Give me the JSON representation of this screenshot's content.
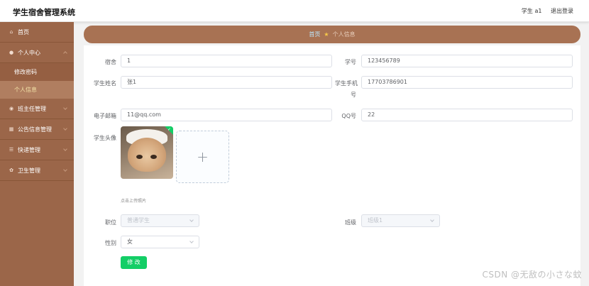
{
  "header": {
    "title": "学生宿舍管理系统",
    "user": "学生 a1",
    "logout": "退出登录"
  },
  "sidebar": {
    "items": [
      {
        "label": "首页",
        "icon": "home-icon"
      },
      {
        "label": "个人中心",
        "icon": "user-icon"
      },
      {
        "label": "班主任管理",
        "icon": "location-icon"
      },
      {
        "label": "公告信息管理",
        "icon": "grid-icon"
      },
      {
        "label": "快递管理",
        "icon": "list-icon"
      },
      {
        "label": "卫生管理",
        "icon": "settings-icon"
      }
    ],
    "sub_items": [
      {
        "label": "修改密码"
      },
      {
        "label": "个人信息"
      }
    ]
  },
  "breadcrumb": {
    "home": "首页",
    "current": "个人信息"
  },
  "form": {
    "dorm_label": "宿舍",
    "dorm_value": "1",
    "student_no_label": "学号",
    "student_no_value": "123456789",
    "name_label": "学生姓名",
    "name_value": "张1",
    "phone_label_1": "学生手机",
    "phone_label_2": "号",
    "phone_value": "17703786901",
    "email_label": "电子邮箱",
    "email_value": "11@qq.com",
    "qq_label": "QQ号",
    "qq_value": "22",
    "avatar_label": "学生头像",
    "upload_plus": "+",
    "upload_tip": "点击上传照片",
    "position_label": "职位",
    "position_value": "普通学生",
    "class_label": "班级",
    "class_value": "班级1",
    "gender_label": "性别",
    "gender_value": "女",
    "submit_label": "修 改"
  },
  "watermark": "CSDN @无敌の小さな蚊",
  "colors": {
    "sidebar": "#9b6649",
    "breadcrumb": "#a87253",
    "primary_button": "#13ce66"
  }
}
